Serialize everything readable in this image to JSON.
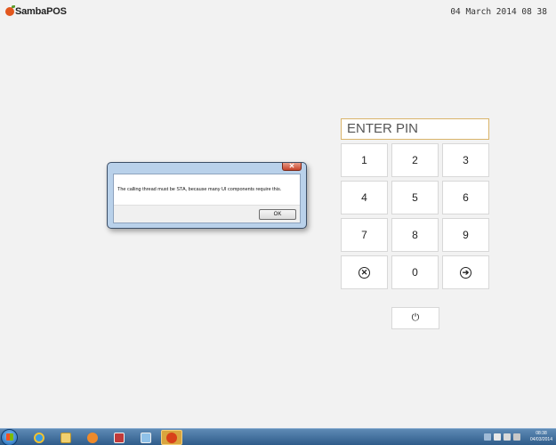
{
  "header": {
    "app_name": "SambaPOS",
    "datetime": "04 March 2014 08 38"
  },
  "pin_pad": {
    "display_text": "ENTER PIN",
    "keys": [
      "1",
      "2",
      "3",
      "4",
      "5",
      "6",
      "7",
      "8",
      "9",
      "0"
    ],
    "clear_icon_glyph": "✕",
    "enter_icon_glyph": "➔",
    "power_icon_glyph": "⏻"
  },
  "dialog": {
    "close_glyph": "✕",
    "message": "The calling thread must be STA, because many UI components require this.",
    "ok_label": "OK"
  },
  "taskbar": {
    "time": "08:38",
    "date": "04/03/2014"
  }
}
